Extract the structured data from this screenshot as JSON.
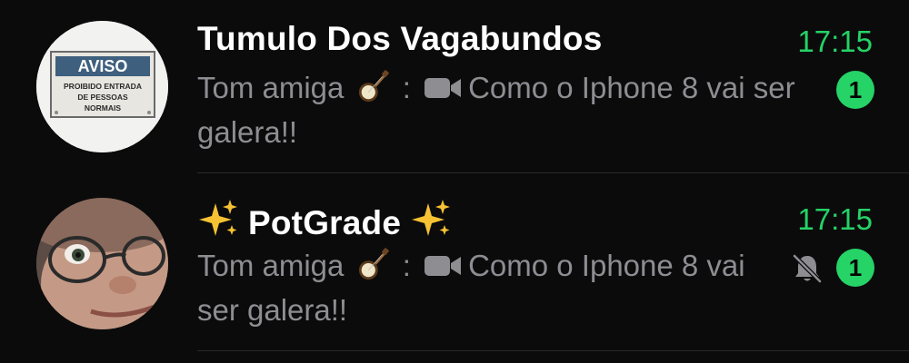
{
  "chats": [
    {
      "name": "Tumulo Dos Vagabundos",
      "time": "17:15",
      "sender": "Tom amiga",
      "separator": ":",
      "message": "Como o Iphone 8 vai ser galera!!",
      "unread_count": "1",
      "muted": false,
      "avatar_sign": {
        "title": "AVISO",
        "line1": "PROIBIDO ENTRADA",
        "line2": "DE PESSOAS",
        "line3": "NORMAIS"
      }
    },
    {
      "name": "PotGrade",
      "time": "17:15",
      "sender": "Tom amiga",
      "separator": ":",
      "message": "Como o Iphone 8 vai ser galera!!",
      "unread_count": "1",
      "muted": true
    }
  ],
  "icons": {
    "sender_emoji": "banjo-icon",
    "media": "video-camera-icon",
    "name_decoration": "sparkles-icon",
    "muted": "bell-slash-icon"
  },
  "colors": {
    "background": "#0b0b0c",
    "accent_green": "#25d366",
    "preview_gray": "#8d8d92",
    "title_white": "#ffffff"
  }
}
